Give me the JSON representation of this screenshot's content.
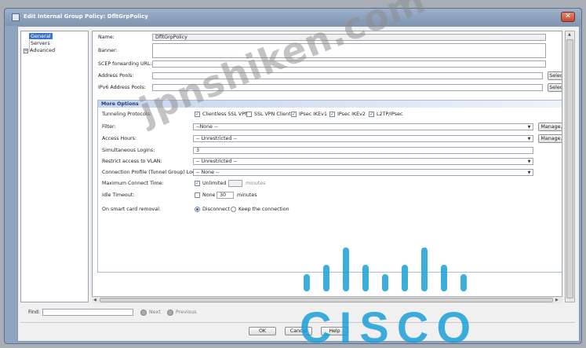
{
  "window": {
    "title": "Edit Internal Group Policy: DfltGrpPolicy",
    "close_glyph": "✕"
  },
  "tree": {
    "items": [
      {
        "label": "General",
        "selected": true
      },
      {
        "label": "Servers",
        "selected": false
      },
      {
        "label": "Advanced",
        "selected": false,
        "expander": "+"
      }
    ]
  },
  "form": {
    "name_label": "Name:",
    "name_value": "DfltGrpPolicy",
    "banner_label": "Banner:",
    "scep_label": "SCEP forwarding URL:",
    "address_pools_label": "Address Pools:",
    "ipv6_pools_label": "IPv6 Address Pools:",
    "select_button": "Select...",
    "more_options": "More Options",
    "tunneling_label": "Tunneling Protocols:",
    "protocols": [
      {
        "label": "Clientless SSL VPN",
        "checked": true
      },
      {
        "label": "SSL VPN Client",
        "checked": false
      },
      {
        "label": "IPsec IKEv1",
        "checked": true
      },
      {
        "label": "IPsec IKEv2",
        "checked": true
      },
      {
        "label": "L2TP/IPsec",
        "checked": true
      }
    ],
    "filter_label": "Filter:",
    "filter_value": "--None --",
    "access_hours_label": "Access Hours:",
    "access_hours_value": "-- Unrestricted --",
    "manage_button": "Manage...",
    "sim_logins_label": "Simultaneous Logins:",
    "sim_logins_value": "3",
    "vlan_label": "Restrict access to VLAN:",
    "vlan_value": "-- Unrestricted --",
    "conn_profile_label": "Connection Profile (Tunnel Group) Lock:",
    "conn_profile_value": "-- None --",
    "max_connect_label": "Maximum Connect Time:",
    "unlimited_label": "Unlimited",
    "minutes_label": "minutes",
    "idle_label": "Idle Timeout:",
    "none_label": "None",
    "idle_value": "30",
    "smart_card_label": "On smart card removal:",
    "disconnect_label": "Disconnect",
    "keep_label": "Keep the connection"
  },
  "find": {
    "label": "Find:",
    "next": "Next",
    "previous": "Previous"
  },
  "buttons": {
    "ok": "OK",
    "cancel": "Cancel",
    "help": "Help"
  },
  "watermark": {
    "site": "jpnshiken.com",
    "logo": "CISCO"
  },
  "colors": {
    "selection": "#3b73c6",
    "section_title": "#1f3f7a",
    "cisco_blue": "#1ba0d7"
  }
}
